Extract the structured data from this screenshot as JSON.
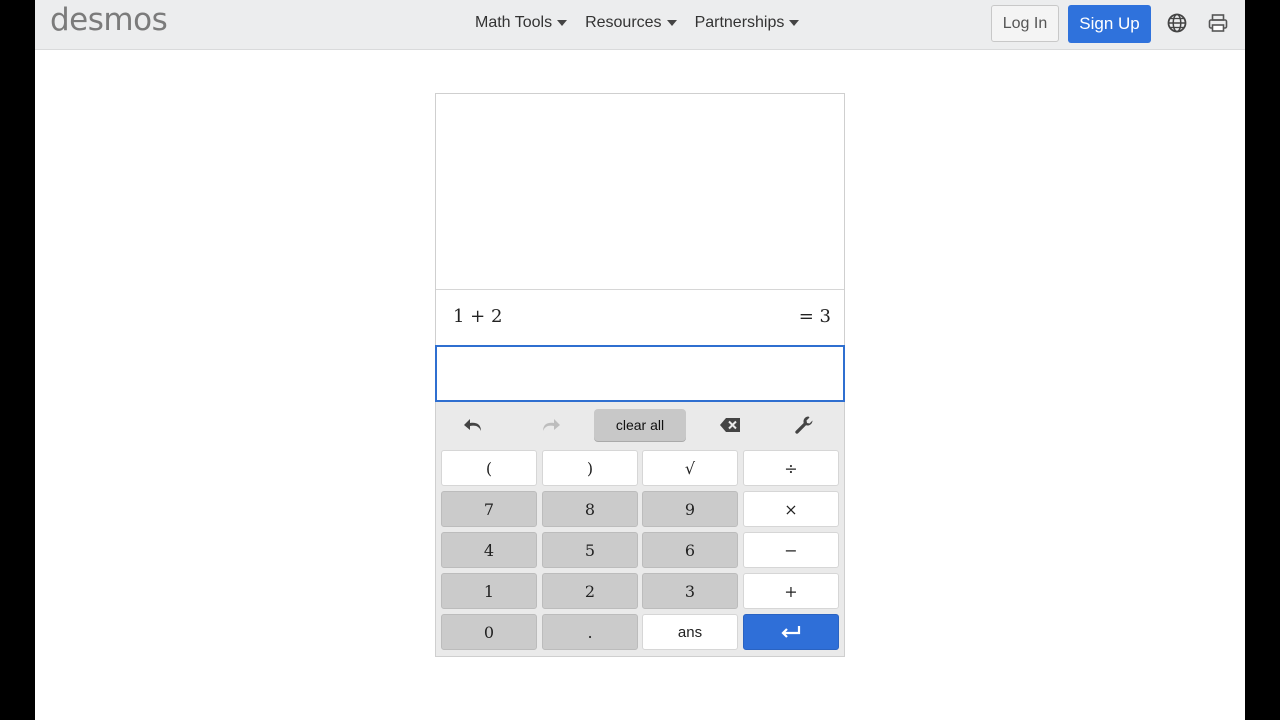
{
  "header": {
    "logo": "desmos",
    "nav": [
      {
        "label": "Math Tools"
      },
      {
        "label": "Resources"
      },
      {
        "label": "Partnerships"
      }
    ],
    "login_label": "Log In",
    "signup_label": "Sign Up",
    "icons": [
      "globe-icon",
      "printer-icon"
    ]
  },
  "calculator": {
    "history": [
      {
        "expression": "1 + 2",
        "result": "= 3"
      }
    ],
    "input_value": "",
    "toolbar": {
      "clear_all_label": "clear all",
      "icons": [
        "undo-icon",
        "redo-icon",
        "backspace-icon",
        "wrench-icon"
      ]
    },
    "keys": [
      [
        "(",
        ")",
        "√",
        "÷"
      ],
      [
        "7",
        "8",
        "9",
        "×"
      ],
      [
        "4",
        "5",
        "6",
        "−"
      ],
      [
        "1",
        "2",
        "3",
        "+"
      ],
      [
        "0",
        ".",
        "ans",
        "⮐"
      ]
    ]
  },
  "colors": {
    "accent": "#2f72dc",
    "topbar_bg": "#ecedee",
    "keypad_bg": "#eaeaea",
    "dark_key": "#cbcbcb"
  }
}
